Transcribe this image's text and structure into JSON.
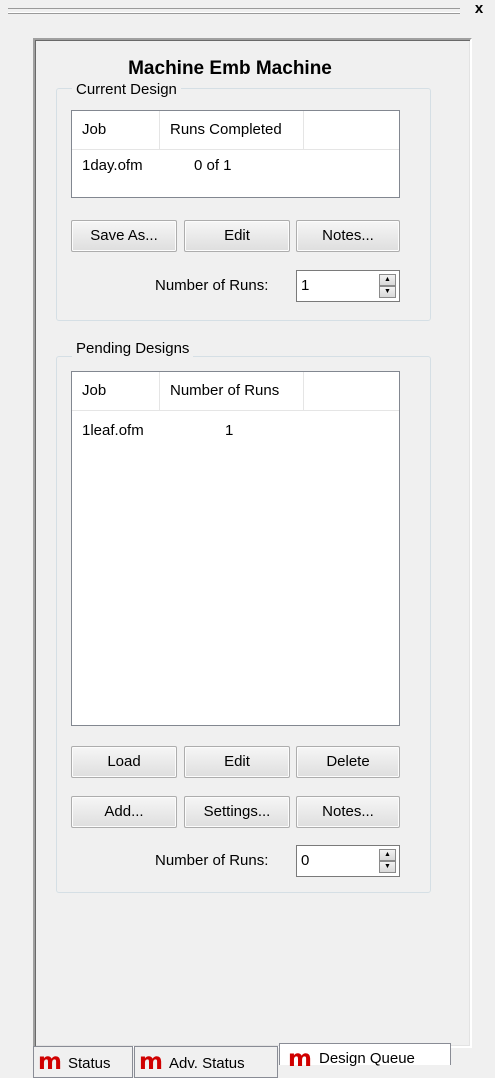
{
  "window": {
    "close_glyph": "x"
  },
  "title": "Machine Emb Machine",
  "current_design": {
    "legend": "Current Design",
    "columns": [
      "Job",
      "Runs Completed"
    ],
    "rows": [
      {
        "job": "1day.ofm",
        "runs": "0 of 1"
      }
    ],
    "buttons": {
      "save_as": "Save As...",
      "edit": "Edit",
      "notes": "Notes..."
    },
    "runs_label": "Number of Runs:",
    "runs_value": "1"
  },
  "pending_designs": {
    "legend": "Pending Designs",
    "columns": [
      "Job",
      "Number of Runs"
    ],
    "rows": [
      {
        "job": "1leaf.ofm",
        "runs": "1"
      }
    ],
    "buttons": {
      "load": "Load",
      "edit": "Edit",
      "delete": "Delete",
      "add": "Add...",
      "settings": "Settings...",
      "notes": "Notes..."
    },
    "runs_label": "Number of Runs:",
    "runs_value": "0"
  },
  "tabs": [
    {
      "logo": "m",
      "label": "Status",
      "active": false
    },
    {
      "logo": "m",
      "label": "Adv. Status",
      "active": false
    },
    {
      "logo": "m",
      "label": "Design Queue",
      "active": true
    }
  ],
  "colors": {
    "logo": "#d00000",
    "background": "#f0f0f0"
  }
}
